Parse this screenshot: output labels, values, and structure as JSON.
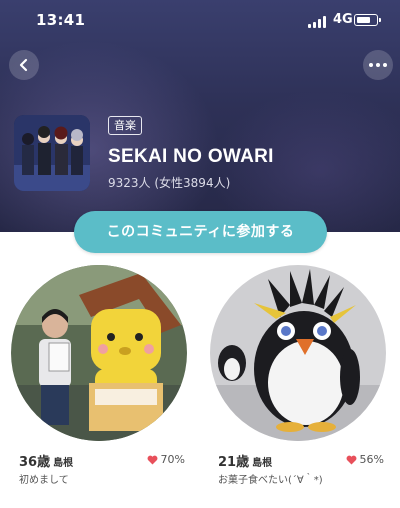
{
  "status_bar": {
    "time": "13:41",
    "network": "4G"
  },
  "header": {
    "back_icon": "chevron-left-icon",
    "more_icon": "more-dots-icon"
  },
  "community": {
    "category": "音楽",
    "name": "SEKAI NO OWARI",
    "members": "9323人 (女性3894人)"
  },
  "join_button": {
    "label": "このコミュニティに参加する",
    "color": "#5bbdc8"
  },
  "users": [
    {
      "age": "36歳",
      "region": "島根",
      "match": "70%",
      "bio": "初めまして"
    },
    {
      "age": "21歳",
      "region": "島根",
      "match": "56%",
      "bio": "お菓子食べたい(´∀｀*)"
    }
  ],
  "colors": {
    "header_bg": "#2e3157",
    "heart": "#e8505b",
    "accent": "#5bbdc8"
  }
}
